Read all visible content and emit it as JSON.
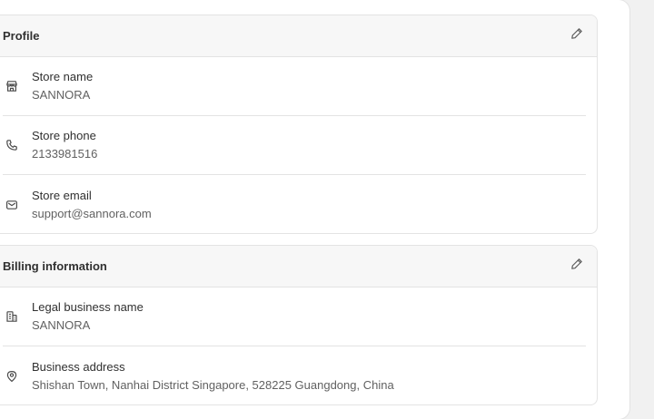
{
  "profile": {
    "title": "Profile",
    "edit_icon": "pencil-icon",
    "rows": [
      {
        "icon": "store-icon",
        "label": "Store name",
        "value": "SANNORA"
      },
      {
        "icon": "phone-icon",
        "label": "Store phone",
        "value": "2133981516"
      },
      {
        "icon": "email-icon",
        "label": "Store email",
        "value": "support@sannora.com"
      }
    ]
  },
  "billing": {
    "title": "Billing information",
    "edit_icon": "pencil-icon",
    "rows": [
      {
        "icon": "building-icon",
        "label": "Legal business name",
        "value": "SANNORA"
      },
      {
        "icon": "location-pin-icon",
        "label": "Business address",
        "value": "Shishan Town, Nanhai District Singapore, 528225 Guangdong, China"
      }
    ]
  },
  "colors": {
    "text": "#303030",
    "subdued_text": "#616161",
    "border": "#e3e3e3",
    "header_bg": "#f7f7f7"
  }
}
